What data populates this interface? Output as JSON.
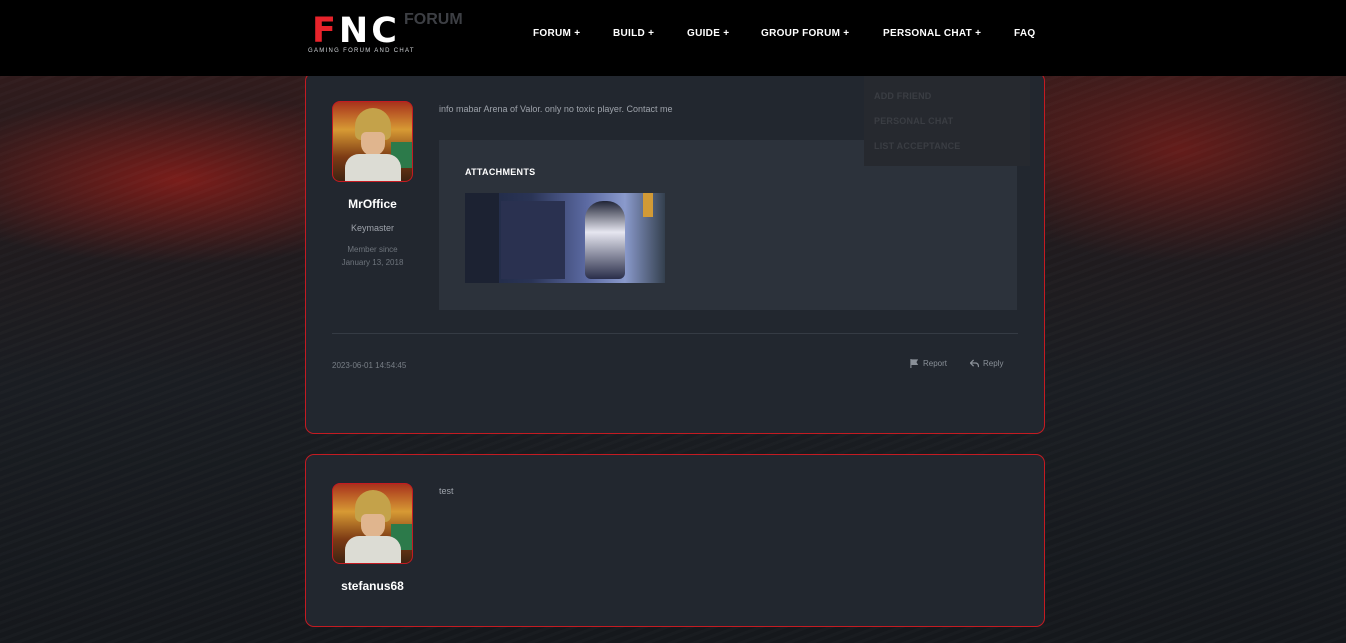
{
  "brand": {
    "logo_mark": "FNC",
    "logo_ghost": "FORUM",
    "tagline": "GAMING FORUM AND CHAT"
  },
  "nav": [
    {
      "label": "FORUM +"
    },
    {
      "label": "BUILD +"
    },
    {
      "label": "GUIDE +"
    },
    {
      "label": "GROUP FORUM +"
    },
    {
      "label": "PERSONAL CHAT +"
    },
    {
      "label": "FAQ"
    }
  ],
  "dropdown": [
    {
      "label": "ADD FRIEND"
    },
    {
      "label": "PERSONAL CHAT"
    },
    {
      "label": "LIST ACCEPTANCE"
    }
  ],
  "posts": [
    {
      "author": "MrOffice",
      "role": "Keymaster",
      "member_since_label": "Member since",
      "member_since_date": "January 13, 2018",
      "content": "info mabar Arena of Valor. only no toxic player. Contact me",
      "attachments_title": "ATTACHMENTS",
      "date": "2023-06-01 14:54:45",
      "report_label": "Report",
      "reply_label": "Reply"
    },
    {
      "author": "stefanus68",
      "content": "test"
    }
  ],
  "colors": {
    "accent_red": "#c41b22",
    "card_bg": "#22272f",
    "header_bg": "#000000"
  },
  "icons": {
    "report": "flag-icon",
    "reply": "reply-arrow-icon"
  }
}
